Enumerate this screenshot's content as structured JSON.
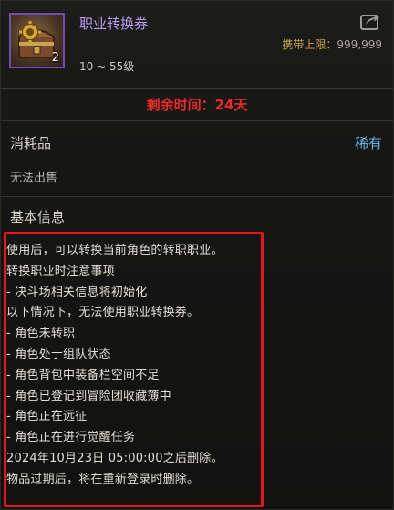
{
  "item": {
    "name": "职业转换券",
    "stack_count": "2",
    "level_range": "10 ~ 55级",
    "carry_limit_label": "携带上限：",
    "carry_limit_value": "999,999",
    "icon": "treasure-chest-gear-icon",
    "share_icon": "share-arrow-icon"
  },
  "remaining_time": "剩余时间：24天",
  "category": {
    "label": "消耗品",
    "rarity": "稀有",
    "trade_status": "无法出售"
  },
  "basic_info": {
    "title": "基本信息",
    "description_lines": [
      "使用后，可以转换当前角色的转职职业。",
      "转换职业时注意事项",
      "- 决斗场相关信息将初始化",
      "以下情况下，无法使用职业转换券。",
      "- 角色未转职",
      "- 角色处于组队状态",
      "- 角色背包中装备栏空间不足",
      "- 角色已登记到冒险团收藏簿中",
      "- 角色正在远征",
      "- 角色正在进行觉醒任务",
      "2024年10月23日 05:00:00之后删除。",
      "物品过期后，将在重新登录时删除。"
    ]
  },
  "colors": {
    "item_name": "#b79cf0",
    "remaining_time": "#ea2a2a",
    "rarity": "#6db3e6",
    "carry_label": "#c7a24c",
    "highlight_border": "#e5141e",
    "item_frame": "#6e4fb0"
  }
}
